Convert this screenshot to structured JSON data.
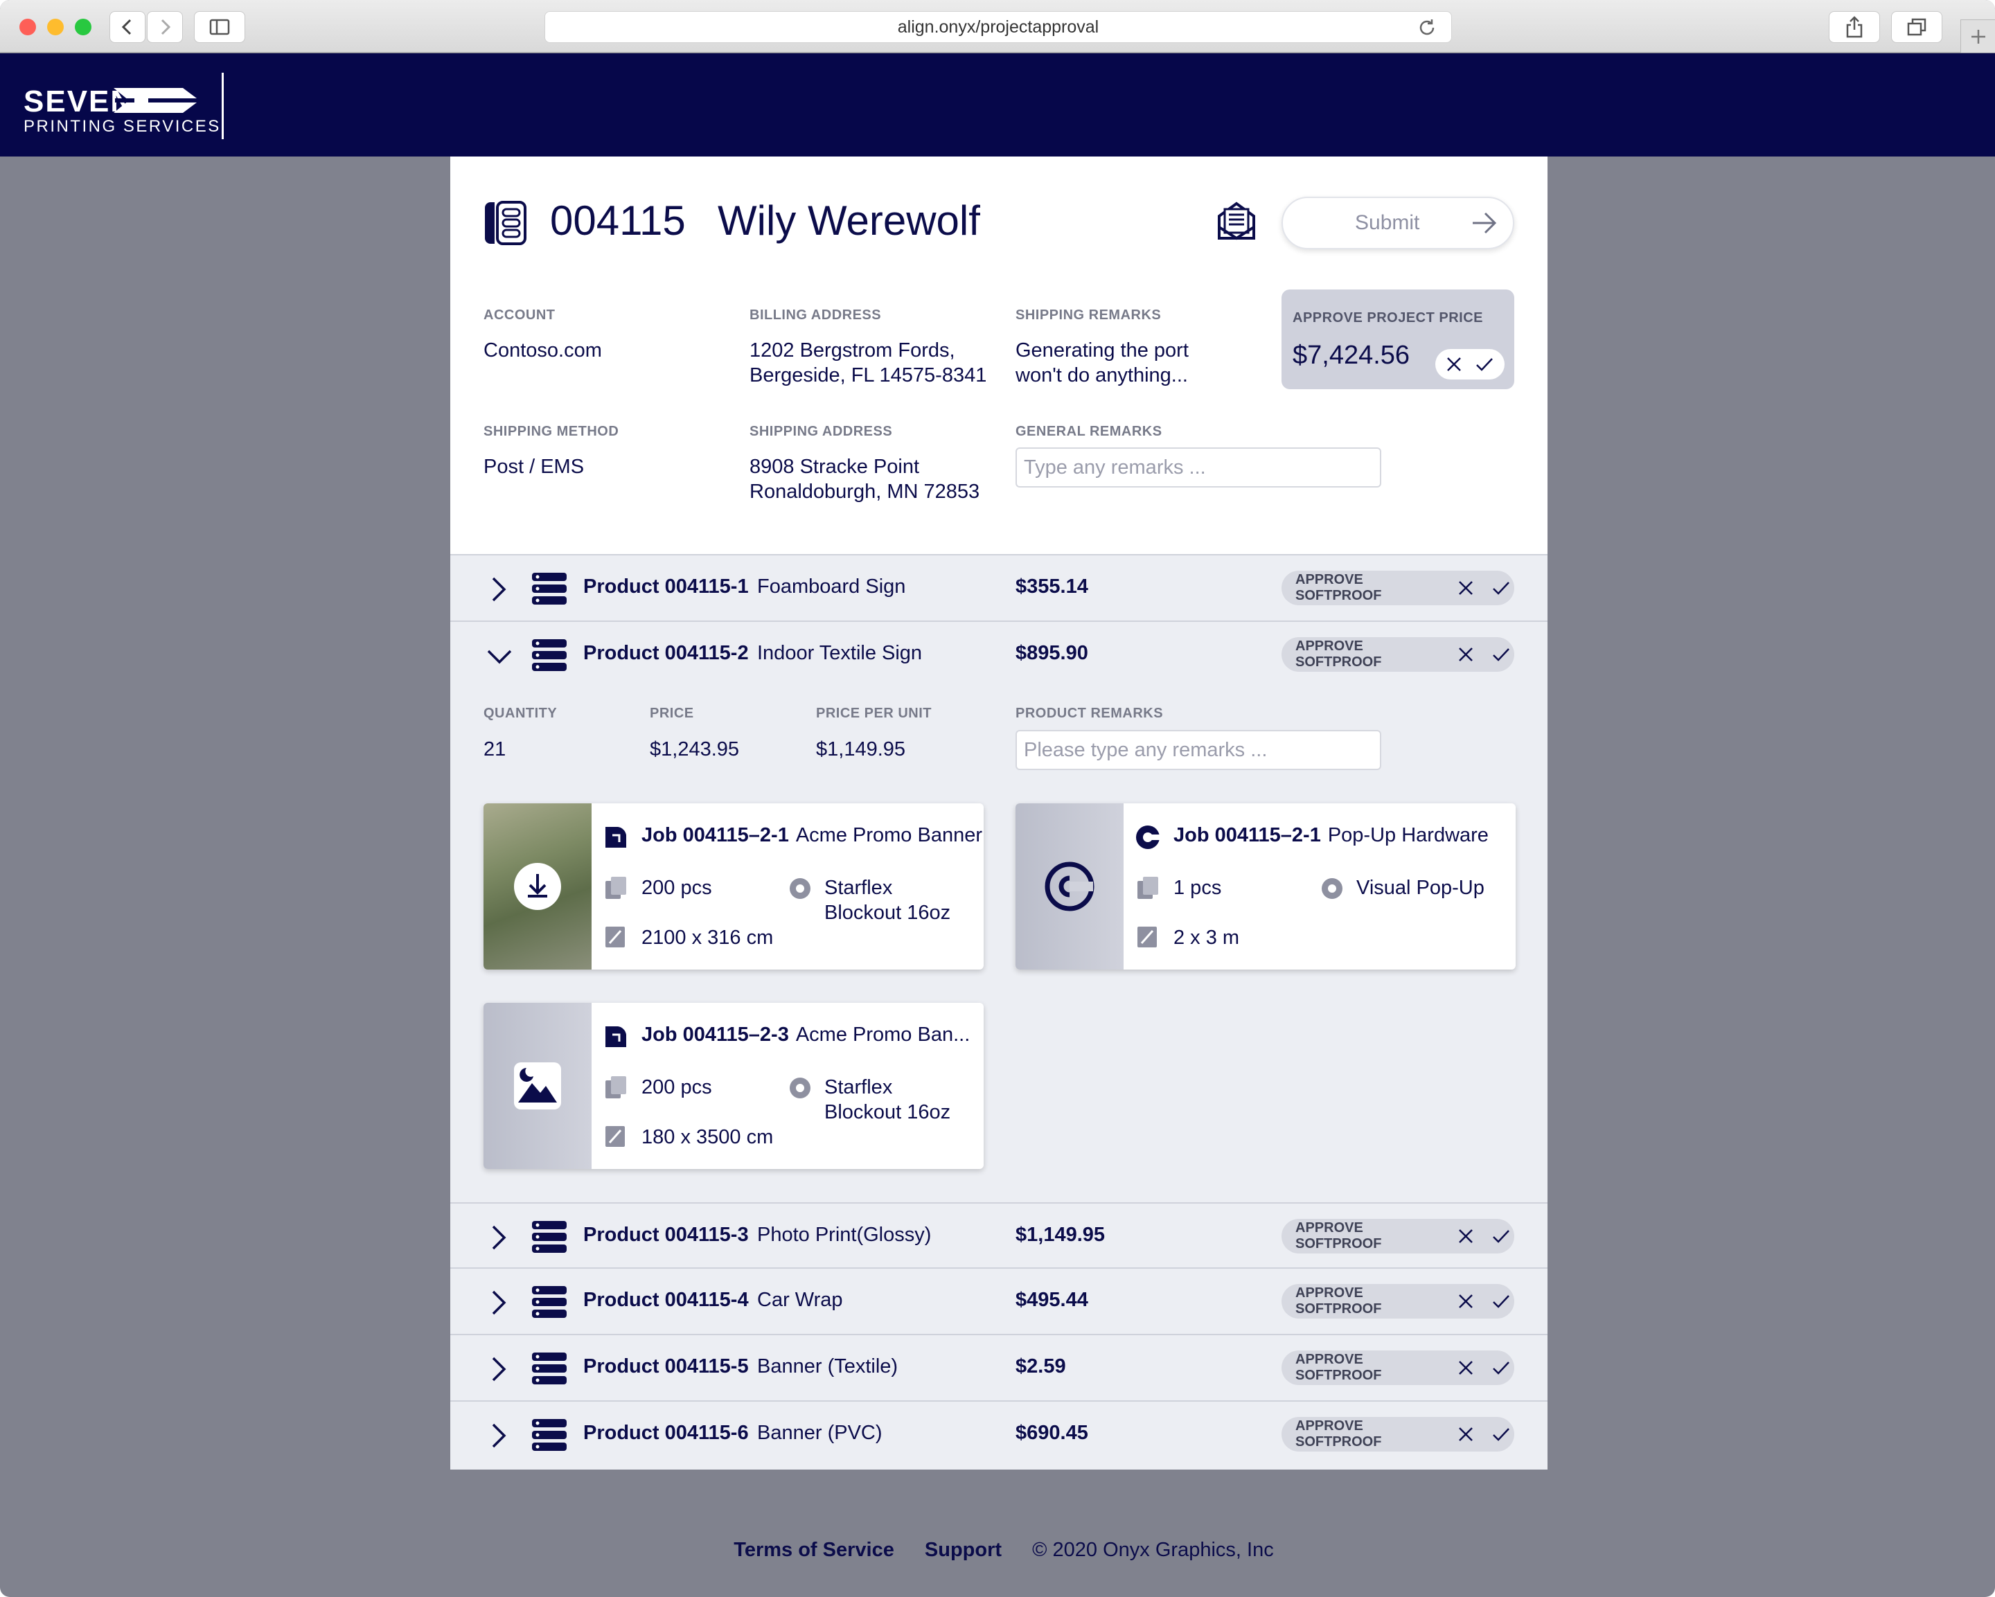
{
  "browser": {
    "url": "align.onyx/projectapproval"
  },
  "brand": {
    "name": "SEVEN",
    "subtitle": "PRINTING SERVICES"
  },
  "project": {
    "id": "004115",
    "name": "Wily Werewolf",
    "submit_label": "Submit",
    "account_label": "ACCOUNT",
    "account": "Contoso.com",
    "billing_label": "BILLING ADDRESS",
    "billing_line1": "1202 Bergstrom Fords,",
    "billing_line2": "Bergeside, FL 14575-8341",
    "ship_remarks_label": "SHIPPING REMARKS",
    "ship_remarks_line1": "Generating the port",
    "ship_remarks_line2": "won't do anything...",
    "approve_label": "APPROVE PROJECT PRICE",
    "approve_price": "$7,424.56",
    "ship_method_label": "SHIPPING METHOD",
    "ship_method": "Post / EMS",
    "ship_address_label": "SHIPPING ADDRESS",
    "ship_address_line1": "8908 Stracke Point",
    "ship_address_line2": "Ronaldoburgh, MN 72853",
    "general_remarks_label": "GENERAL REMARKS",
    "general_remarks_placeholder": "Type any remarks ..."
  },
  "products": [
    {
      "id": "Product 004115-1",
      "name": "Foamboard Sign",
      "price": "$355.14",
      "approve": "APPROVE SOFTPROOF"
    },
    {
      "id": "Product 004115-2",
      "name": "Indoor Textile Sign",
      "price": "$895.90",
      "approve": "APPROVE SOFTPROOF"
    },
    {
      "id": "Product 004115-3",
      "name": "Photo Print(Glossy)",
      "price": "$1,149.95",
      "approve": "APPROVE SOFTPROOF"
    },
    {
      "id": "Product 004115-4",
      "name": "Car Wrap",
      "price": "$495.44",
      "approve": "APPROVE SOFTPROOF"
    },
    {
      "id": "Product 004115-5",
      "name": "Banner (Textile)",
      "price": "$2.59",
      "approve": "APPROVE SOFTPROOF"
    },
    {
      "id": "Product 004115-6",
      "name": "Banner (PVC)",
      "price": "$690.45",
      "approve": "APPROVE SOFTPROOF"
    }
  ],
  "expanded": {
    "quantity_label": "QUANTITY",
    "quantity": "21",
    "price_label": "PRICE",
    "price": "$1,243.95",
    "ppu_label": "PRICE PER UNIT",
    "ppu": "$1,149.95",
    "remarks_label": "PRODUCT REMARKS",
    "remarks_placeholder": "Please type any remarks ...",
    "jobs": [
      {
        "id": "Job 004115–2-1",
        "name": "Acme Promo Banner",
        "qty": "200 pcs",
        "material1": "Starflex",
        "material2": "Blockout 16oz",
        "size": "2100 x 316 cm"
      },
      {
        "id": "Job 004115–2-1",
        "name": "Pop-Up Hardware",
        "qty": "1 pcs",
        "material1": "Visual Pop-Up",
        "material2": "",
        "size": "2 x 3 m"
      },
      {
        "id": "Job 004115–2-3",
        "name": "Acme Promo Ban...",
        "qty": "200 pcs",
        "material1": "Starflex",
        "material2": "Blockout 16oz",
        "size": "180 x 3500 cm"
      }
    ]
  },
  "footer": {
    "terms": "Terms of Service",
    "support": "Support",
    "copyright": "© 2020 Onyx Graphics, Inc"
  },
  "colors": {
    "navy": "#06074a",
    "page_bg": "#80828e",
    "panel": "#eceef3"
  }
}
